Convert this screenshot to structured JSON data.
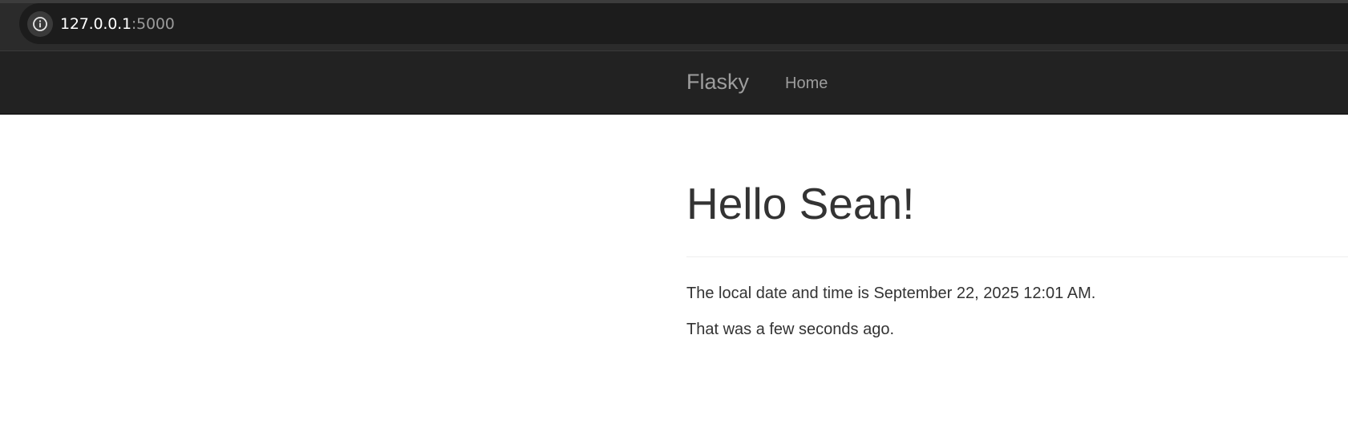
{
  "browser": {
    "url_host": "127.0.0.1",
    "url_port": ":5000",
    "info_icon": "info-icon"
  },
  "navbar": {
    "brand": "Flasky",
    "items": [
      {
        "label": "Home"
      }
    ]
  },
  "main": {
    "title": "Hello Sean!",
    "datetime_line": "The local date and time is September 22, 2025 12:01 AM.",
    "relative_line": "That was a few seconds ago."
  },
  "colors": {
    "navbar_bg": "#222222",
    "nav_text": "#9d9d9d",
    "body_text": "#333333",
    "browser_bg": "#1c1c1c"
  }
}
